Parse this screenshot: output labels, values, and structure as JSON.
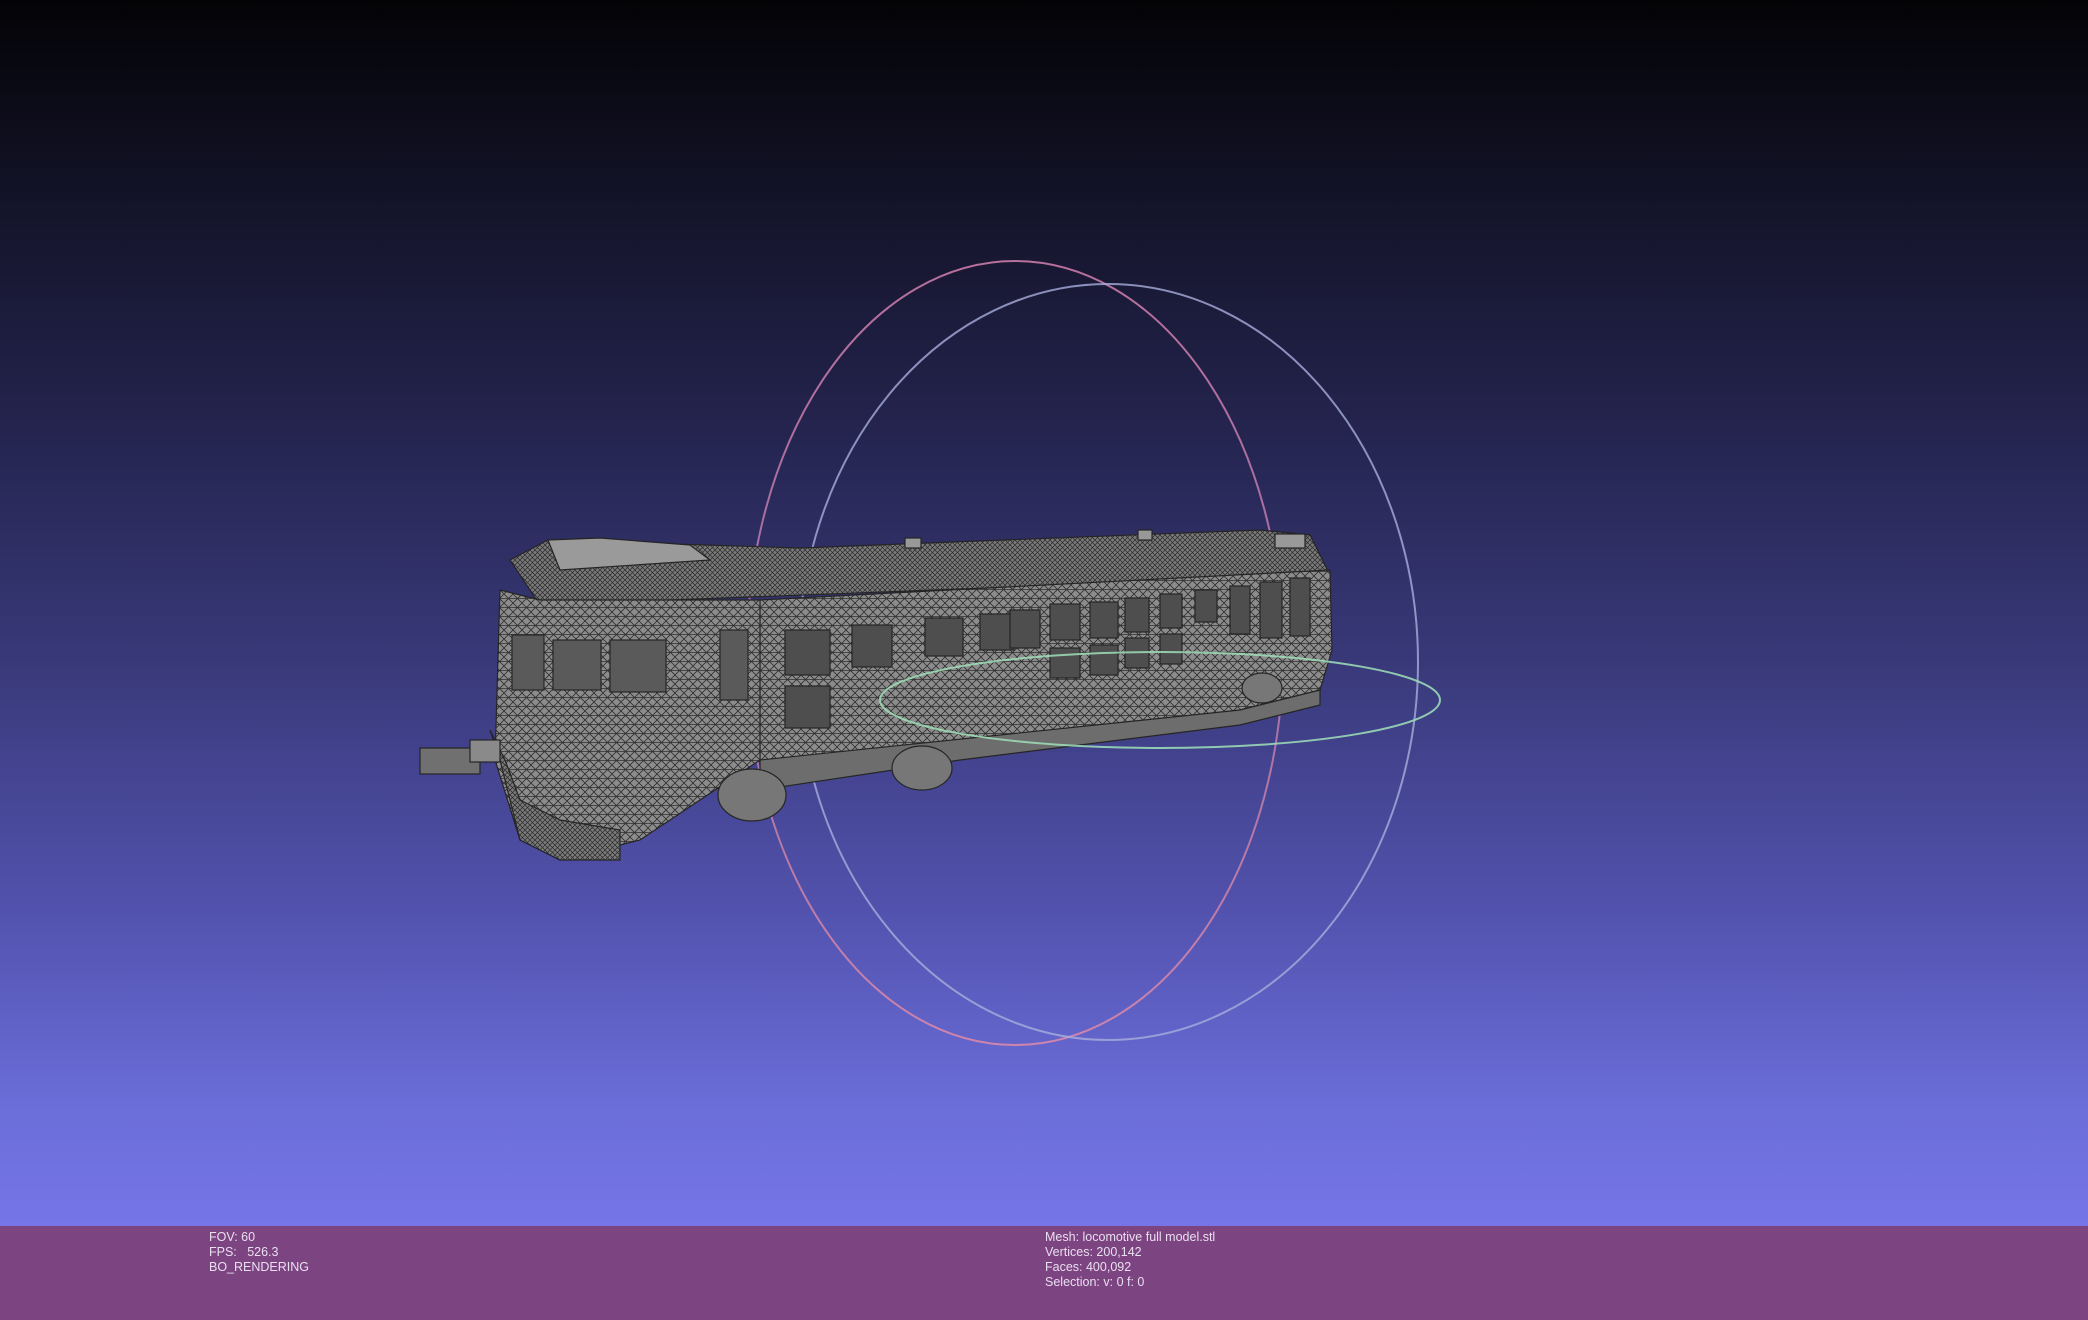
{
  "viewer": {
    "background_top": "#030306",
    "background_bottom": "#7675e8",
    "mesh_color": "#8f8f8f",
    "trackball_colors": {
      "x": "#e37aa6",
      "y": "#9aa4d8",
      "z": "#9fe0b8"
    }
  },
  "scene": {
    "model": "locomotive-mesh",
    "render_mode": "wireframe-flat"
  },
  "info_left": {
    "fov": "FOV: 60",
    "fps": "FPS:   526.3",
    "mode": "BO_RENDERING"
  },
  "info_right": {
    "mesh": "Mesh: locomotive full model.stl",
    "vertices": "Vertices: 200,142",
    "faces": "Faces: 400,092",
    "selection": "Selection: v: 0 f: 0"
  }
}
